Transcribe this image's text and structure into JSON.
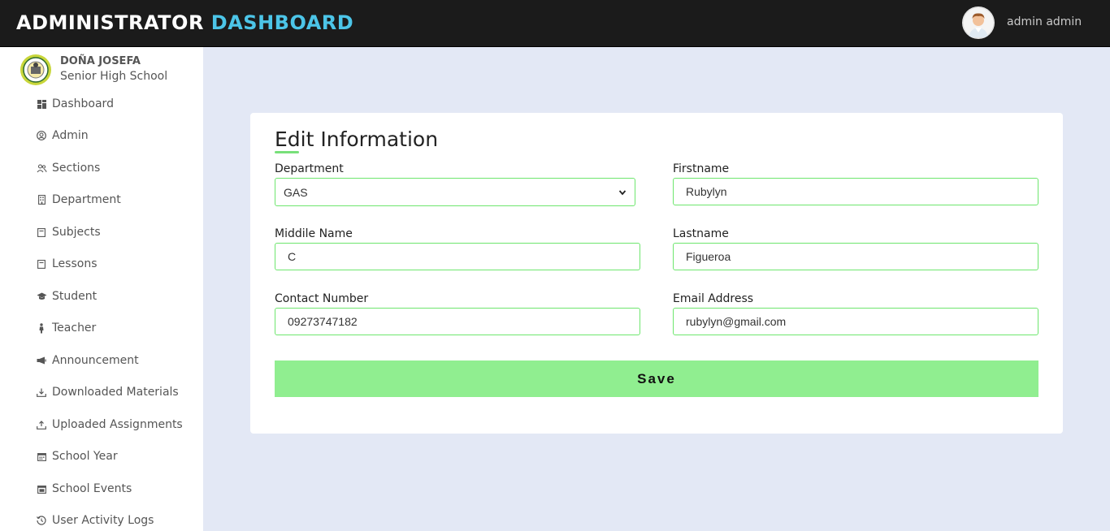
{
  "header": {
    "brand_main": "ADMINISTRATOR",
    "brand_accent": "DASHBOARD",
    "user_name": "admin admin"
  },
  "sidebar": {
    "school_name": "DOÑA JOSEFA",
    "school_sub": "Senior High School",
    "items": [
      {
        "label": "Dashboard",
        "icon": "dashboard-icon"
      },
      {
        "label": "Admin",
        "icon": "user-circle-icon"
      },
      {
        "label": "Sections",
        "icon": "users-icon"
      },
      {
        "label": "Department",
        "icon": "building-icon"
      },
      {
        "label": "Subjects",
        "icon": "book-icon"
      },
      {
        "label": "Lessons",
        "icon": "book-icon"
      },
      {
        "label": "Student",
        "icon": "graduation-cap-icon"
      },
      {
        "label": "Teacher",
        "icon": "person-icon"
      },
      {
        "label": "Announcement",
        "icon": "megaphone-icon"
      },
      {
        "label": "Downloaded Materials",
        "icon": "download-icon"
      },
      {
        "label": "Uploaded Assignments",
        "icon": "upload-icon"
      },
      {
        "label": "School Year",
        "icon": "calendar-icon"
      },
      {
        "label": "School Events",
        "icon": "calendar-event-icon"
      },
      {
        "label": "User Activity Logs",
        "icon": "history-icon"
      }
    ]
  },
  "form": {
    "title": "Edit Information",
    "department": {
      "label": "Department",
      "value": "GAS"
    },
    "firstname": {
      "label": "Firstname",
      "value": "Rubylyn"
    },
    "middle_name": {
      "label": "Middile Name",
      "value": "C"
    },
    "lastname": {
      "label": "Lastname",
      "value": "Figueroa"
    },
    "contact": {
      "label": "Contact Number",
      "value": "09273747182"
    },
    "email": {
      "label": "Email Address",
      "value": "rubylyn@gmail.com"
    },
    "save_label": "Save"
  },
  "colors": {
    "topbar": "#1b1b1b",
    "accent": "#4cc5e8",
    "input_border": "#6ee66e",
    "save_button": "#90ee90",
    "page_bg": "#e3e8f5"
  }
}
